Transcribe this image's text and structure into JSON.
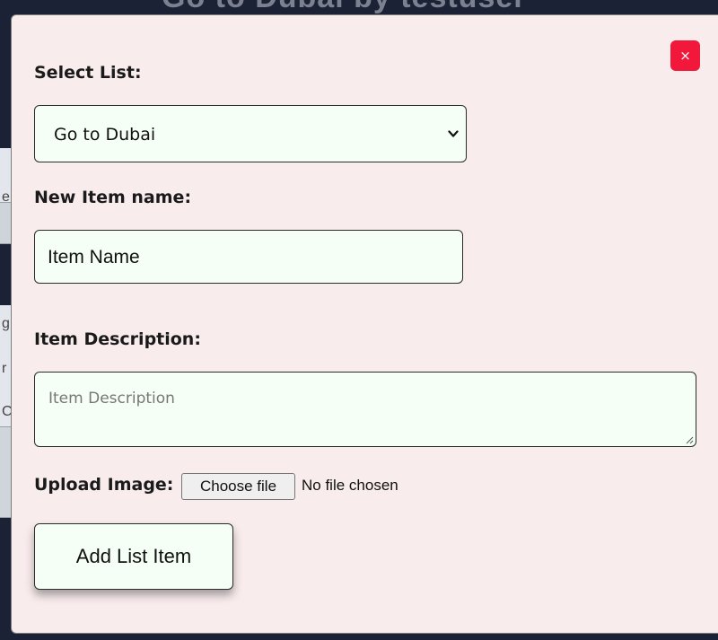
{
  "background": {
    "title": "Go to Dubai by testuser",
    "edge_chars": [
      "e",
      "g",
      "r",
      "C"
    ]
  },
  "modal": {
    "close_label": "×",
    "select": {
      "label": "Select List:",
      "value": "Go to Dubai"
    },
    "item_name": {
      "label": "New Item name:",
      "value": "Item Name"
    },
    "item_description": {
      "label": "Item Description:",
      "placeholder": "Item Description"
    },
    "upload": {
      "label": "Upload Image:",
      "button_label": "Choose file",
      "status": "No file chosen"
    },
    "submit_label": "Add List Item"
  },
  "colors": {
    "modal_bg": "#f9eced",
    "field_bg": "#f6fff5",
    "close_red": "#f2183c",
    "page_bg": "#1b2236"
  },
  "icons": {
    "close": "close-icon",
    "select_arrow": "chevron-down-icon",
    "textarea_resize": "resize-handle-icon"
  }
}
